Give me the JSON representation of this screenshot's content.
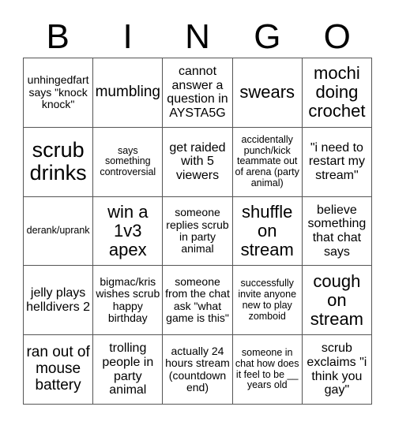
{
  "header": {
    "letters": [
      "B",
      "I",
      "N",
      "G",
      "O"
    ]
  },
  "cells": [
    {
      "text": "unhingedfart says \"knock knock\"",
      "size": "sm"
    },
    {
      "text": "mumbling",
      "size": "lg"
    },
    {
      "text": "cannot answer a question in AYSTA5G",
      "size": "md"
    },
    {
      "text": "swears",
      "size": "xl"
    },
    {
      "text": "mochi doing crochet",
      "size": "xl"
    },
    {
      "text": "scrub drinks",
      "size": "xxl"
    },
    {
      "text": "says something controversial",
      "size": "xs"
    },
    {
      "text": "get raided with 5 viewers",
      "size": "md"
    },
    {
      "text": "accidentally punch/kick teammate out of arena (party animal)",
      "size": "xs"
    },
    {
      "text": "\"i need to restart my stream\"",
      "size": "md"
    },
    {
      "text": "derank/uprank",
      "size": "xs"
    },
    {
      "text": "win a 1v3 apex",
      "size": "xl"
    },
    {
      "text": "someone replies scrub in party animal",
      "size": "sm"
    },
    {
      "text": "shuffle on stream",
      "size": "xl"
    },
    {
      "text": "believe something that chat says",
      "size": "md"
    },
    {
      "text": "jelly plays helldivers 2",
      "size": "md"
    },
    {
      "text": "bigmac/kris wishes scrub happy birthday",
      "size": "sm"
    },
    {
      "text": "someone from the chat ask \"what game is this\"",
      "size": "sm"
    },
    {
      "text": "successfully invite anyone new to play zomboid",
      "size": "xs"
    },
    {
      "text": "cough on stream",
      "size": "xl"
    },
    {
      "text": "ran out of mouse battery",
      "size": "lg"
    },
    {
      "text": "trolling people in party animal",
      "size": "md"
    },
    {
      "text": "actually 24 hours stream (countdown end)",
      "size": "sm"
    },
    {
      "text": "someone in chat how does it feel to be __ years old",
      "size": "xs"
    },
    {
      "text": "scrub exclaims \"i think you gay\"",
      "size": "md"
    }
  ]
}
